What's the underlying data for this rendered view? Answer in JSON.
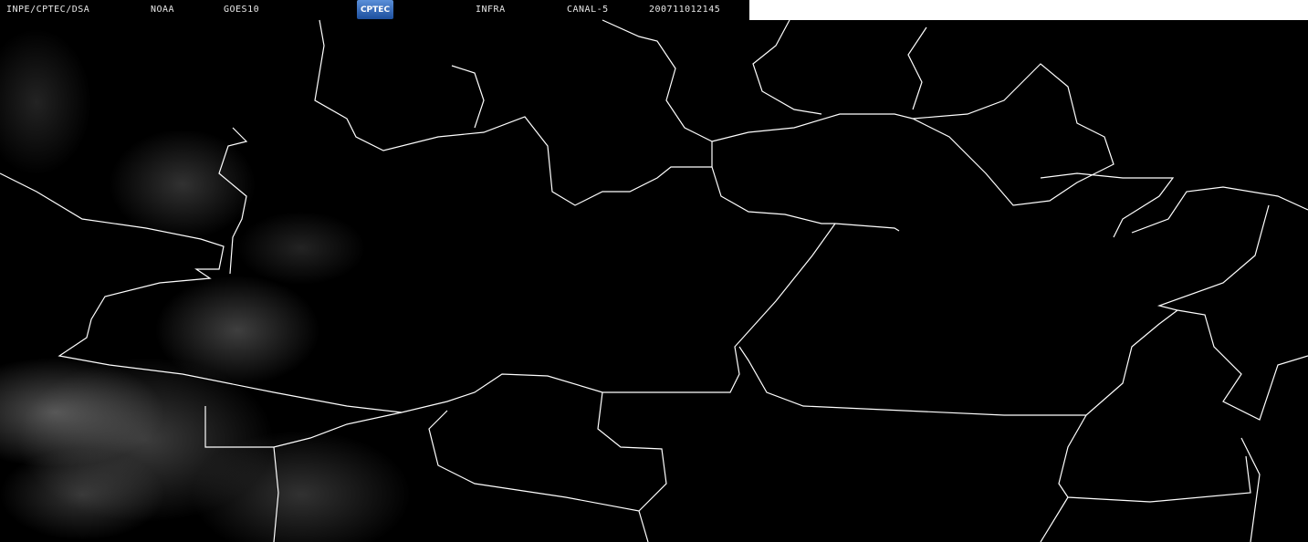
{
  "header": {
    "source": "INPE/CPTEC/DSA",
    "agency": "NOAA",
    "satellite": "GOES10",
    "logo_text": "CPTEC",
    "band": "INFRA",
    "channel": "CANAL-5",
    "datetime": "200711012145"
  }
}
